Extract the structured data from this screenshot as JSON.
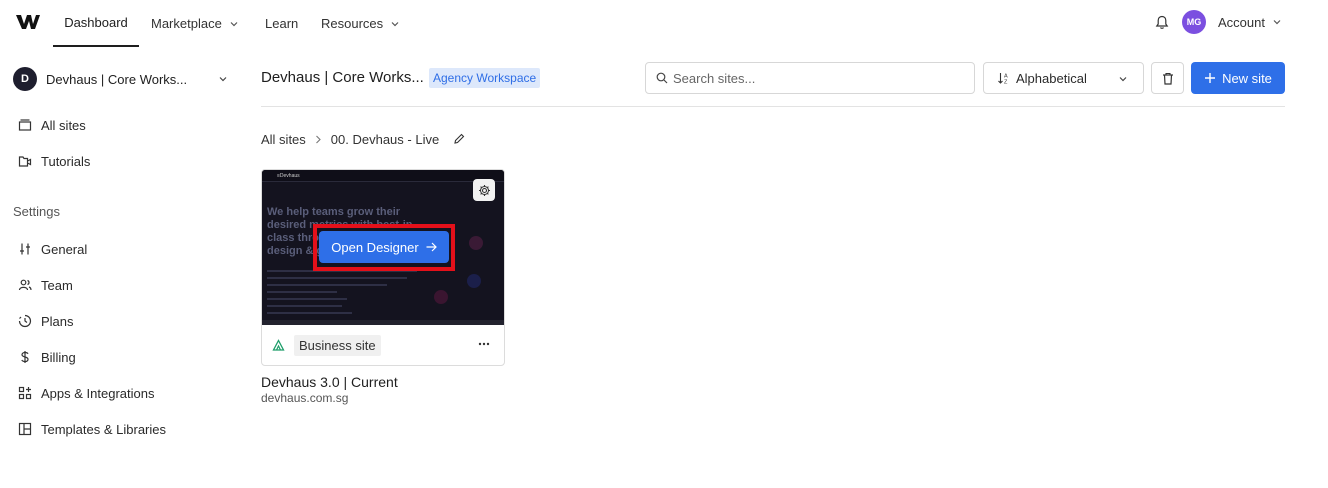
{
  "nav": {
    "items": [
      {
        "label": "Dashboard",
        "active": true
      },
      {
        "label": "Marketplace",
        "dropdown": true
      },
      {
        "label": "Learn"
      },
      {
        "label": "Resources",
        "dropdown": true
      }
    ],
    "avatar_initials": "MG",
    "account_label": "Account"
  },
  "sidebar": {
    "workspace_initial": "D",
    "workspace_name": "Devhaus | Core Works...",
    "items": [
      {
        "label": "All sites",
        "icon": "folder-icon"
      },
      {
        "label": "Tutorials",
        "icon": "video-icon"
      }
    ],
    "settings_heading": "Settings",
    "settings_items": [
      {
        "label": "General",
        "icon": "sliders-icon"
      },
      {
        "label": "Team",
        "icon": "team-icon"
      },
      {
        "label": "Plans",
        "icon": "plans-icon"
      },
      {
        "label": "Billing",
        "icon": "dollar-icon"
      },
      {
        "label": "Apps & Integrations",
        "icon": "apps-icon"
      },
      {
        "label": "Templates & Libraries",
        "icon": "templates-icon"
      }
    ]
  },
  "header": {
    "title": "Devhaus | Core Works...",
    "workspace_tag": "Agency Workspace",
    "search_placeholder": "Search sites...",
    "sort_label": "Alphabetical",
    "new_site_label": "New site"
  },
  "breadcrumb": {
    "root": "All sites",
    "current": "00. Devhaus - Live"
  },
  "site_card": {
    "thumb_brand": "≡Devhaus",
    "thumb_headline": "We help teams grow their desired metrics with best-in-class through Devhaus design & growth",
    "open_label": "Open Designer",
    "plan_label": "Business site",
    "site_name": "Devhaus 3.0 | Current",
    "site_url": "devhaus.com.sg"
  },
  "colors": {
    "primary": "#2e6fe8",
    "highlight_border": "#e4101a",
    "avatar": "#7b4fe0",
    "tag_bg": "#dde8fb"
  }
}
